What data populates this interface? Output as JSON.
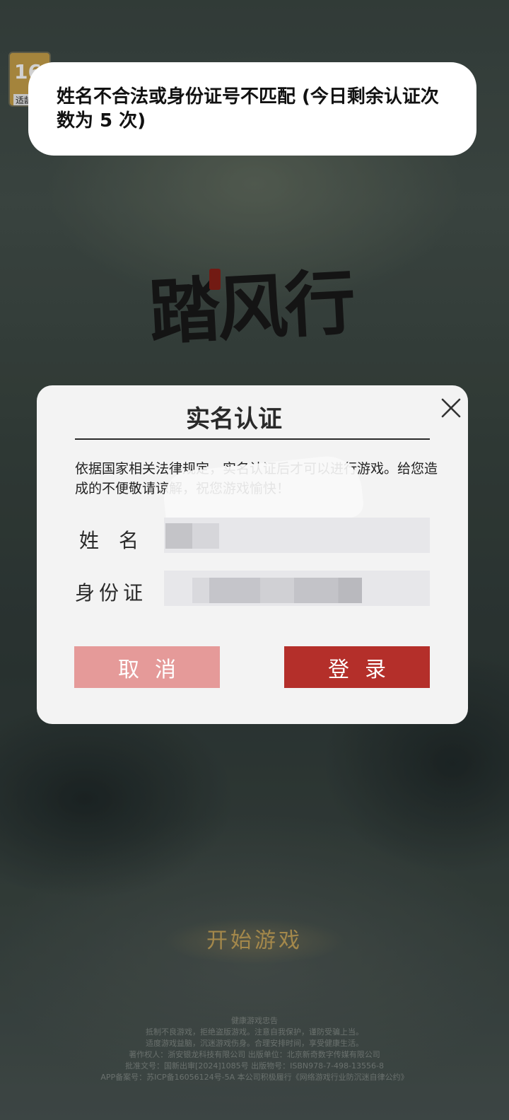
{
  "background": {
    "age_badge": {
      "number": "16",
      "label": "适龄"
    },
    "game_logo": "踏风行",
    "start_button_label": "开始游戏",
    "footer_lines": [
      "健康游戏忠告",
      "抵制不良游戏，拒绝盗版游戏。注意自我保护，谨防受骗上当。",
      "适度游戏益脑，沉迷游戏伤身。合理安排时间，享受健康生活。",
      "著作权人：浙安银龙科技有限公司    出版单位：北京新奇数字传媒有限公司",
      "批准文号：国新出审[2024]1085号    出版物号：ISBN978-7-498-13556-8",
      "APP备案号：苏ICP备16056124号-5A    本公司积极履行《网络游戏行业防沉迷自律公约》"
    ]
  },
  "toast": {
    "message": "姓名不合法或身份证号不匹配 (今日剩余认证次数为 5 次)"
  },
  "dialog": {
    "title": "实名认证",
    "notice": "依据国家相关法律规定，实名认证后才可以进行游戏。给您造成的不便敬请谅解，祝您游戏愉快！",
    "name_label": "姓名",
    "id_label": "身份证",
    "name_value": "",
    "id_value": "",
    "cancel_label": "取消",
    "login_label": "登录"
  },
  "colors": {
    "cancel_button": "#e59a99",
    "login_button": "#b42f2a",
    "dialog_bg": "#f3f3f3"
  }
}
